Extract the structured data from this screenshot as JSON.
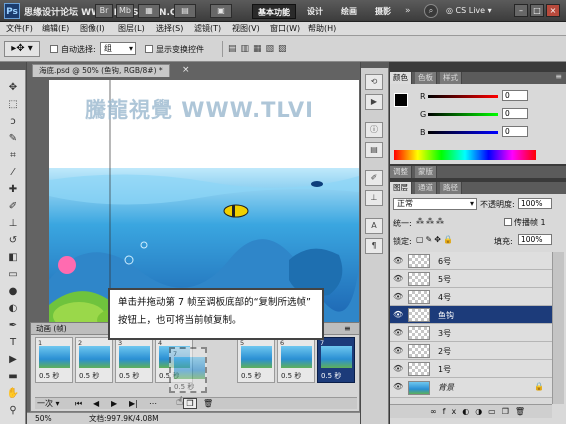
{
  "titlebar": {
    "app_logo": "Ps",
    "brand_watermark": "思缘设计论坛 WWW.MISSYUAN.COM",
    "workspaces": [
      "基本功能",
      "设计",
      "绘画",
      "摄影"
    ],
    "cslive": "CS Live"
  },
  "menubar": {
    "items": [
      "文件(F)",
      "编辑(E)",
      "图像(I)",
      "图层(L)",
      "选择(S)",
      "滤镜(T)",
      "视图(V)",
      "窗口(W)",
      "帮助(H)"
    ]
  },
  "options": {
    "auto_select_label": "自动选择:",
    "auto_select_value": "组",
    "show_transform_label": "显示变换控件"
  },
  "document": {
    "tab_title": "海底.psd @ 50% (鱼钩, RGB/8#) *",
    "watermark": "騰龍視覺 WWW.TLVI"
  },
  "color_panel": {
    "tabs": [
      "颜色",
      "色板",
      "样式"
    ],
    "r_label": "R",
    "r_value": "0",
    "g_label": "G",
    "g_value": "0",
    "b_label": "B",
    "b_value": "0"
  },
  "adjust_panel": {
    "tabs": [
      "调整",
      "蒙版"
    ]
  },
  "layers_panel": {
    "tabs": [
      "图层",
      "通道",
      "路径"
    ],
    "blend_mode": "正常",
    "opacity_label": "不透明度:",
    "opacity_value": "100%",
    "unify_label": "统一:",
    "propagate_label": "传播帧 1",
    "lock_label": "锁定:",
    "fill_label": "填充:",
    "fill_value": "100%",
    "layers": [
      {
        "name": "6号",
        "selected": false
      },
      {
        "name": "5号",
        "selected": false
      },
      {
        "name": "4号",
        "selected": false
      },
      {
        "name": "鱼钩",
        "selected": true
      },
      {
        "name": "3号",
        "selected": false
      },
      {
        "name": "2号",
        "selected": false
      },
      {
        "name": "1号",
        "selected": false
      },
      {
        "name": "背景",
        "selected": false
      }
    ]
  },
  "animation_panel": {
    "title": "动画 (帧)",
    "frames": [
      {
        "num": "1",
        "delay": "0.5 秒"
      },
      {
        "num": "2",
        "delay": "0.5 秒"
      },
      {
        "num": "3",
        "delay": "0.5 秒"
      },
      {
        "num": "4",
        "delay": "0.5 秒"
      },
      {
        "num": "7",
        "delay": "0.5 秒"
      },
      {
        "num": "5",
        "delay": "0.5 秒"
      },
      {
        "num": "6",
        "delay": "0.5 秒"
      },
      {
        "num": "7",
        "delay": "0.5 秒"
      }
    ],
    "loop": "一次"
  },
  "callout": {
    "text": "单击并拖动第 7 帧至调板底部的“复制所选帧” 按钮上，也可将当前帧复制。"
  },
  "status": {
    "zoom": "50%",
    "doc_info": "文档:997.9K/4.08M"
  }
}
